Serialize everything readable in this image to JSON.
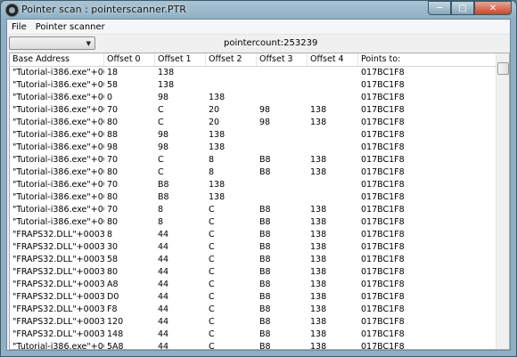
{
  "window": {
    "title": "Pointer scan : pointerscanner.PTR"
  },
  "menu": [
    "File",
    "Pointer scanner"
  ],
  "toolbar": {
    "combo_value": "",
    "pointercount": "pointercount:253239"
  },
  "table": {
    "columns": [
      "Base Address",
      "Offset 0",
      "Offset 1",
      "Offset 2",
      "Offset 3",
      "Offset 4",
      "Points to:"
    ],
    "rows": [
      [
        "\"Tutorial-i386.exe\"+00...",
        "18",
        "138",
        "",
        "",
        "",
        "017BC1F8"
      ],
      [
        "\"Tutorial-i386.exe\"+00...",
        "58",
        "138",
        "",
        "",
        "",
        "017BC1F8"
      ],
      [
        "\"Tutorial-i386.exe\"+00...",
        "0",
        "98",
        "138",
        "",
        "",
        "017BC1F8"
      ],
      [
        "\"Tutorial-i386.exe\"+00...",
        "70",
        "C",
        "20",
        "98",
        "138",
        "017BC1F8"
      ],
      [
        "\"Tutorial-i386.exe\"+00...",
        "80",
        "C",
        "20",
        "98",
        "138",
        "017BC1F8"
      ],
      [
        "\"Tutorial-i386.exe\"+00...",
        "88",
        "98",
        "138",
        "",
        "",
        "017BC1F8"
      ],
      [
        "\"Tutorial-i386.exe\"+00...",
        "98",
        "98",
        "138",
        "",
        "",
        "017BC1F8"
      ],
      [
        "\"Tutorial-i386.exe\"+00...",
        "70",
        "C",
        "8",
        "B8",
        "138",
        "017BC1F8"
      ],
      [
        "\"Tutorial-i386.exe\"+00...",
        "80",
        "C",
        "8",
        "B8",
        "138",
        "017BC1F8"
      ],
      [
        "\"Tutorial-i386.exe\"+00...",
        "70",
        "B8",
        "138",
        "",
        "",
        "017BC1F8"
      ],
      [
        "\"Tutorial-i386.exe\"+00...",
        "80",
        "B8",
        "138",
        "",
        "",
        "017BC1F8"
      ],
      [
        "\"Tutorial-i386.exe\"+00...",
        "70",
        "8",
        "C",
        "B8",
        "138",
        "017BC1F8"
      ],
      [
        "\"Tutorial-i386.exe\"+00...",
        "80",
        "8",
        "C",
        "B8",
        "138",
        "017BC1F8"
      ],
      [
        "\"FRAPS32.DLL\"+0003...",
        "8",
        "44",
        "C",
        "B8",
        "138",
        "017BC1F8"
      ],
      [
        "\"FRAPS32.DLL\"+0003...",
        "30",
        "44",
        "C",
        "B8",
        "138",
        "017BC1F8"
      ],
      [
        "\"FRAPS32.DLL\"+0003...",
        "58",
        "44",
        "C",
        "B8",
        "138",
        "017BC1F8"
      ],
      [
        "\"FRAPS32.DLL\"+0003...",
        "80",
        "44",
        "C",
        "B8",
        "138",
        "017BC1F8"
      ],
      [
        "\"FRAPS32.DLL\"+0003...",
        "A8",
        "44",
        "C",
        "B8",
        "138",
        "017BC1F8"
      ],
      [
        "\"FRAPS32.DLL\"+0003...",
        "D0",
        "44",
        "C",
        "B8",
        "138",
        "017BC1F8"
      ],
      [
        "\"FRAPS32.DLL\"+0003...",
        "F8",
        "44",
        "C",
        "B8",
        "138",
        "017BC1F8"
      ],
      [
        "\"FRAPS32.DLL\"+0003...",
        "120",
        "44",
        "C",
        "B8",
        "138",
        "017BC1F8"
      ],
      [
        "\"FRAPS32.DLL\"+0003...",
        "148",
        "44",
        "C",
        "B8",
        "138",
        "017BC1F8"
      ],
      [
        "\"Tutorial-i386.exe\"+00...",
        "5A8",
        "44",
        "C",
        "B8",
        "138",
        "017BC1F8"
      ]
    ]
  }
}
